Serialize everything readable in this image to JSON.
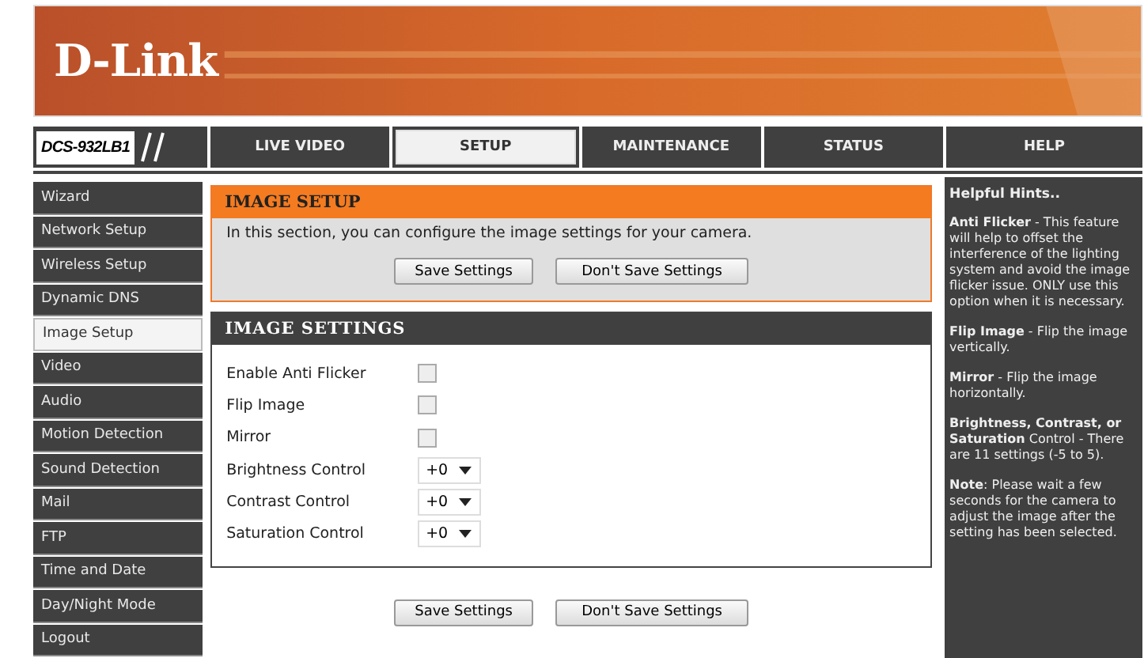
{
  "header": {
    "logo": "D-Link"
  },
  "nav": {
    "model": "DCS-932LB1",
    "tabs": [
      {
        "label": "LIVE VIDEO",
        "selected": false
      },
      {
        "label": "SETUP",
        "selected": true
      },
      {
        "label": "MAINTENANCE",
        "selected": false
      },
      {
        "label": "STATUS",
        "selected": false
      },
      {
        "label": "HELP",
        "selected": false
      }
    ]
  },
  "sidebar": {
    "items": [
      {
        "label": "Wizard",
        "selected": false
      },
      {
        "label": "Network Setup",
        "selected": false
      },
      {
        "label": "Wireless Setup",
        "selected": false
      },
      {
        "label": "Dynamic DNS",
        "selected": false
      },
      {
        "label": "Image Setup",
        "selected": true
      },
      {
        "label": "Video",
        "selected": false
      },
      {
        "label": "Audio",
        "selected": false
      },
      {
        "label": "Motion Detection",
        "selected": false
      },
      {
        "label": "Sound Detection",
        "selected": false
      },
      {
        "label": "Mail",
        "selected": false
      },
      {
        "label": "FTP",
        "selected": false
      },
      {
        "label": "Time and Date",
        "selected": false
      },
      {
        "label": "Day/Night Mode",
        "selected": false
      },
      {
        "label": "Logout",
        "selected": false
      }
    ]
  },
  "image_setup": {
    "title": "IMAGE SETUP",
    "description": "In this section, you can configure the image settings for your camera.",
    "buttons": [
      "Save Settings",
      "Don't Save Settings"
    ]
  },
  "image_settings": {
    "title": "IMAGE SETTINGS",
    "rows": [
      {
        "kind": "checkbox",
        "label": "Enable Anti Flicker",
        "checked": false
      },
      {
        "kind": "checkbox",
        "label": "Flip Image",
        "checked": false
      },
      {
        "kind": "checkbox",
        "label": "Mirror",
        "checked": false
      },
      {
        "kind": "select",
        "label": "Brightness Control",
        "value": "+0"
      },
      {
        "kind": "select",
        "label": "Contrast Control",
        "value": "+0"
      },
      {
        "kind": "select",
        "label": "Saturation Control",
        "value": "+0"
      }
    ]
  },
  "bottom_buttons": [
    "Save Settings",
    "Don't Save Settings"
  ],
  "hints": {
    "title": "Helpful Hints..",
    "paragraphs": [
      "**Anti Flicker** - This feature will help to offset the interference of the lighting system and avoid the image flicker issue. ONLY use this option when it is necessary.",
      "**Flip Image** - Flip the image vertically.",
      "**Mirror** - Flip the image horizontally.",
      "**Brightness, Contrast, or Saturation** Control - There are 11 settings (-5 to 5).",
      "**Note**: Please wait a few seconds for the camera to adjust the image after the setting has been selected."
    ]
  }
}
